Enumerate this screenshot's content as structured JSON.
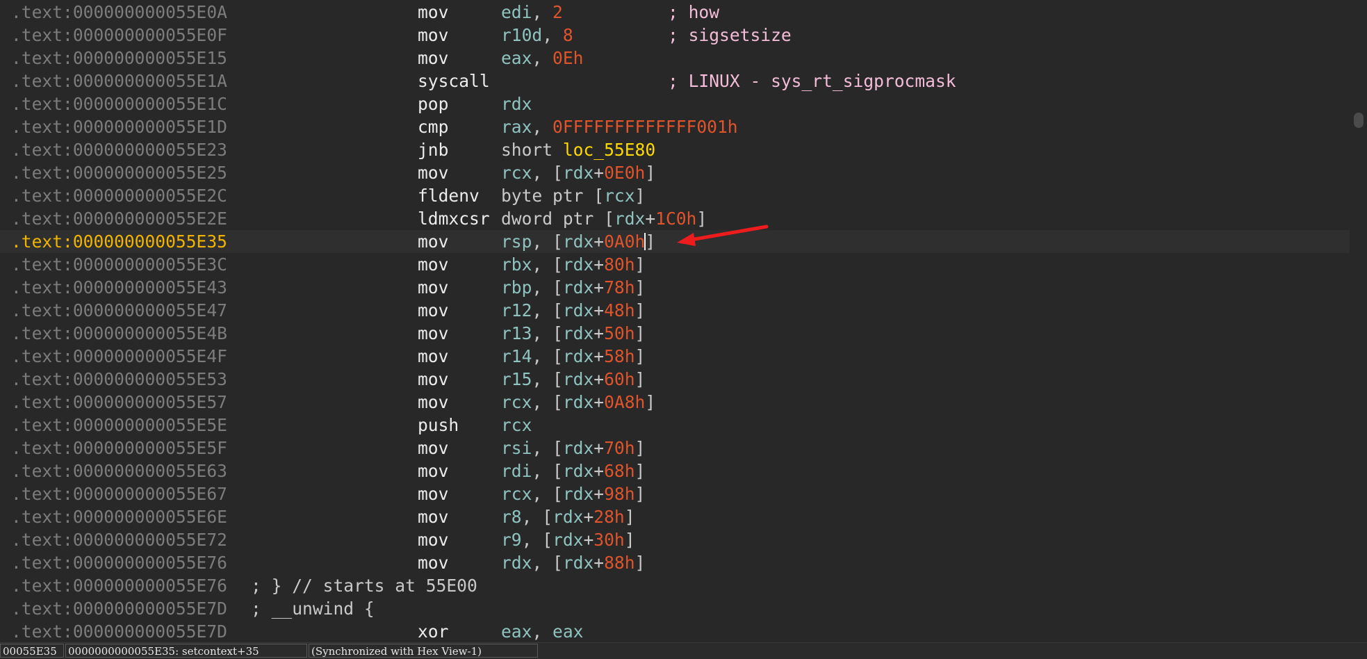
{
  "listing": {
    "lines": [
      {
        "addr": ".text:000000000055E0A",
        "mnemonic": "mov",
        "operands": "edi, 2",
        "comment": "; how"
      },
      {
        "addr": ".text:000000000055E0F",
        "mnemonic": "mov",
        "operands": "r10d, 8",
        "comment": "; sigsetsize"
      },
      {
        "addr": ".text:000000000055E15",
        "mnemonic": "mov",
        "operands": "eax, 0Eh"
      },
      {
        "addr": ".text:000000000055E1A",
        "mnemonic": "syscall",
        "operands": "",
        "comment": "; LINUX - sys_rt_sigprocmask"
      },
      {
        "addr": ".text:000000000055E1C",
        "mnemonic": "pop",
        "operands": "rdx"
      },
      {
        "addr": ".text:000000000055E1D",
        "mnemonic": "cmp",
        "operands": "rax, 0FFFFFFFFFFFFF001h"
      },
      {
        "addr": ".text:000000000055E23",
        "mnemonic": "jnb",
        "operands": "short loc_55E80"
      },
      {
        "addr": ".text:000000000055E25",
        "mnemonic": "mov",
        "operands": "rcx, [rdx+0E0h]"
      },
      {
        "addr": ".text:000000000055E2C",
        "mnemonic": "fldenv",
        "operands": "byte ptr [rcx]"
      },
      {
        "addr": ".text:000000000055E2E",
        "mnemonic": "ldmxcsr",
        "operands": "dword ptr [rdx+1C0h]"
      },
      {
        "addr": ".text:000000000055E35",
        "mnemonic": "mov",
        "operands": "rsp, [rdx+0A0h]",
        "current": true
      },
      {
        "addr": ".text:000000000055E3C",
        "mnemonic": "mov",
        "operands": "rbx, [rdx+80h]"
      },
      {
        "addr": ".text:000000000055E43",
        "mnemonic": "mov",
        "operands": "rbp, [rdx+78h]"
      },
      {
        "addr": ".text:000000000055E47",
        "mnemonic": "mov",
        "operands": "r12, [rdx+48h]"
      },
      {
        "addr": ".text:000000000055E4B",
        "mnemonic": "mov",
        "operands": "r13, [rdx+50h]"
      },
      {
        "addr": ".text:000000000055E4F",
        "mnemonic": "mov",
        "operands": "r14, [rdx+58h]"
      },
      {
        "addr": ".text:000000000055E53",
        "mnemonic": "mov",
        "operands": "r15, [rdx+60h]"
      },
      {
        "addr": ".text:000000000055E57",
        "mnemonic": "mov",
        "operands": "rcx, [rdx+0A8h]"
      },
      {
        "addr": ".text:000000000055E5E",
        "mnemonic": "push",
        "operands": "rcx"
      },
      {
        "addr": ".text:000000000055E5F",
        "mnemonic": "mov",
        "operands": "rsi, [rdx+70h]"
      },
      {
        "addr": ".text:000000000055E63",
        "mnemonic": "mov",
        "operands": "rdi, [rdx+68h]"
      },
      {
        "addr": ".text:000000000055E67",
        "mnemonic": "mov",
        "operands": "rcx, [rdx+98h]"
      },
      {
        "addr": ".text:000000000055E6E",
        "mnemonic": "mov",
        "operands": "r8, [rdx+28h]"
      },
      {
        "addr": ".text:000000000055E72",
        "mnemonic": "mov",
        "operands": "r9, [rdx+30h]"
      },
      {
        "addr": ".text:000000000055E76",
        "mnemonic": "mov",
        "operands": "rdx, [rdx+88h]"
      },
      {
        "addr": ".text:000000000055E76",
        "directive": "; } // starts at 55E00"
      },
      {
        "addr": ".text:000000000055E7D",
        "directive": "; __unwind {"
      },
      {
        "addr": ".text:000000000055E7D",
        "mnemonic": "xor",
        "operands": "eax, eax"
      }
    ]
  },
  "annotation": {
    "arrow_color": "#ee1c1c"
  },
  "statusbar": {
    "address": "00055E35",
    "location": "0000000000055E35: setcontext+35",
    "sync": "(Synchronized with Hex View-1)"
  },
  "colors": {
    "background": "#282828",
    "current_line_address": "#f0b400",
    "number": "#e0542c",
    "label": "#ffd800",
    "comment": "#f3bcd8",
    "register": "#8fc3c0"
  }
}
